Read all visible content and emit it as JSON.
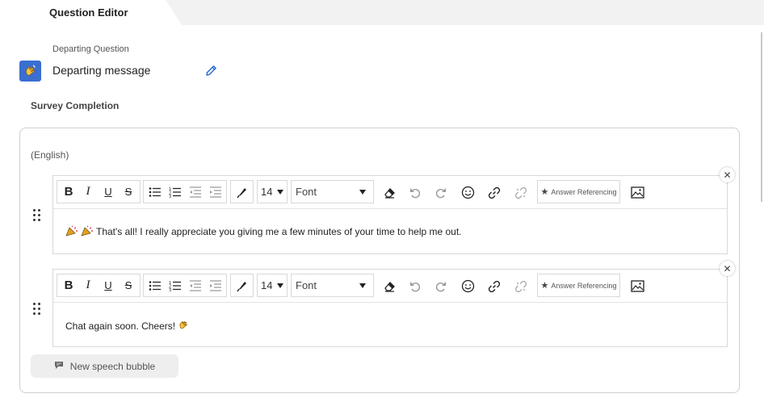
{
  "tab": {
    "label": "Question Editor"
  },
  "question": {
    "subtitle": "Departing Question",
    "title": "Departing message",
    "icon": "waving-hand-icon",
    "accent": "#3a6fd0"
  },
  "section": {
    "title": "Survey Completion"
  },
  "language": {
    "label": "(English)"
  },
  "toolbar": {
    "font_size": "14",
    "font_name": "Font",
    "answer_referencing": "Answer Referencing",
    "icons": [
      "bold-icon",
      "italic-icon",
      "underline-icon",
      "strikethrough-icon",
      "bullet-list-icon",
      "numbered-list-icon",
      "outdent-icon",
      "indent-icon",
      "text-color-icon",
      "clear-format-icon",
      "undo-icon",
      "redo-icon",
      "emoji-icon",
      "link-icon",
      "unlink-icon",
      "star-icon",
      "image-icon"
    ]
  },
  "bubbles": [
    {
      "text": "That's all! I really appreciate you giving me a few minutes of your time to help me out.",
      "emoji": "party-popper"
    },
    {
      "text": "Chat again soon. Cheers!",
      "emoji": "waving-hand"
    }
  ],
  "new_bubble": {
    "label": "New speech bubble"
  }
}
